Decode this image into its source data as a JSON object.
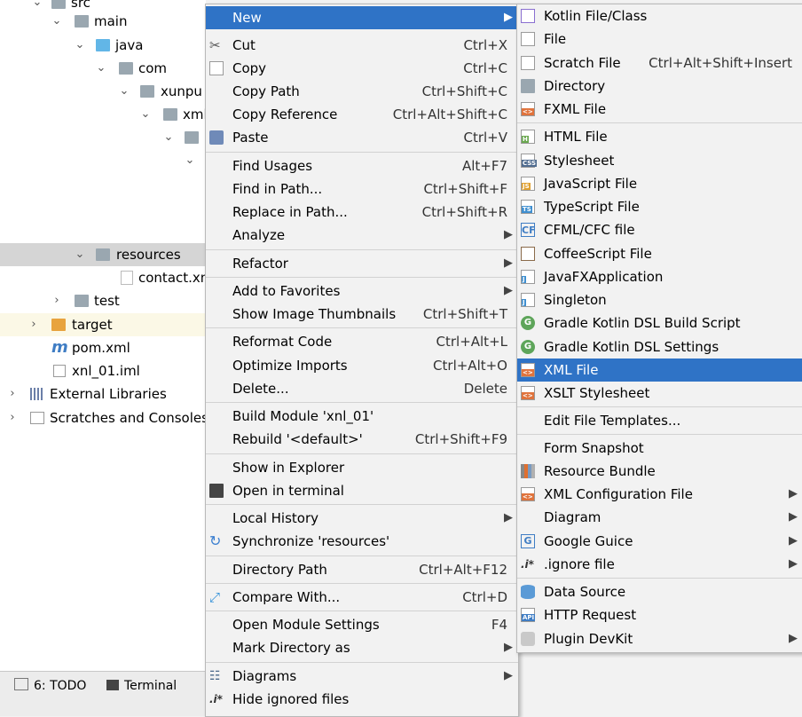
{
  "tree": {
    "rows": [
      {
        "label": "src"
      },
      {
        "label": "main"
      },
      {
        "label": "java"
      },
      {
        "label": "com"
      },
      {
        "label": "xunpu"
      },
      {
        "label": "xml"
      },
      {
        "label": "resources"
      },
      {
        "label": "contact.xml"
      },
      {
        "label": "test"
      },
      {
        "label": "target"
      },
      {
        "label": "pom.xml"
      },
      {
        "label": "xnl_01.iml"
      },
      {
        "label": "External Libraries"
      },
      {
        "label": "Scratches and Consoles"
      }
    ]
  },
  "bottom_tabs": [
    {
      "label": "6: TODO"
    },
    {
      "label": "Terminal"
    }
  ],
  "context_menu": [
    {
      "label": "New",
      "shortcut": ""
    },
    {
      "label": "Cut",
      "shortcut": "Ctrl+X"
    },
    {
      "label": "Copy",
      "shortcut": "Ctrl+C"
    },
    {
      "label": "Copy Path",
      "shortcut": "Ctrl+Shift+C"
    },
    {
      "label": "Copy Reference",
      "shortcut": "Ctrl+Alt+Shift+C"
    },
    {
      "label": "Paste",
      "shortcut": "Ctrl+V"
    },
    {
      "label": "Find Usages",
      "shortcut": "Alt+F7"
    },
    {
      "label": "Find in Path...",
      "shortcut": "Ctrl+Shift+F"
    },
    {
      "label": "Replace in Path...",
      "shortcut": "Ctrl+Shift+R"
    },
    {
      "label": "Analyze",
      "shortcut": ""
    },
    {
      "label": "Refactor",
      "shortcut": ""
    },
    {
      "label": "Add to Favorites",
      "shortcut": ""
    },
    {
      "label": "Show Image Thumbnails",
      "shortcut": "Ctrl+Shift+T"
    },
    {
      "label": "Reformat Code",
      "shortcut": "Ctrl+Alt+L"
    },
    {
      "label": "Optimize Imports",
      "shortcut": "Ctrl+Alt+O"
    },
    {
      "label": "Delete...",
      "shortcut": "Delete"
    },
    {
      "label": "Build Module 'xnl_01'",
      "shortcut": ""
    },
    {
      "label": "Rebuild '<default>'",
      "shortcut": "Ctrl+Shift+F9"
    },
    {
      "label": "Show in Explorer",
      "shortcut": ""
    },
    {
      "label": "Open in terminal",
      "shortcut": ""
    },
    {
      "label": "Local History",
      "shortcut": ""
    },
    {
      "label": "Synchronize 'resources'",
      "shortcut": ""
    },
    {
      "label": "Directory Path",
      "shortcut": "Ctrl+Alt+F12"
    },
    {
      "label": "Compare With...",
      "shortcut": "Ctrl+D"
    },
    {
      "label": "Open Module Settings",
      "shortcut": "F4"
    },
    {
      "label": "Mark Directory as",
      "shortcut": ""
    },
    {
      "label": "Diagrams",
      "shortcut": ""
    },
    {
      "label": "Hide ignored files",
      "shortcut": ""
    }
  ],
  "new_submenu": [
    {
      "label": "Kotlin File/Class",
      "shortcut": ""
    },
    {
      "label": "File",
      "shortcut": ""
    },
    {
      "label": "Scratch File",
      "shortcut": "Ctrl+Alt+Shift+Insert"
    },
    {
      "label": "Directory",
      "shortcut": ""
    },
    {
      "label": "FXML File",
      "shortcut": ""
    },
    {
      "label": "HTML File",
      "shortcut": ""
    },
    {
      "label": "Stylesheet",
      "shortcut": ""
    },
    {
      "label": "JavaScript File",
      "shortcut": ""
    },
    {
      "label": "TypeScript File",
      "shortcut": ""
    },
    {
      "label": "CFML/CFC file",
      "shortcut": ""
    },
    {
      "label": "CoffeeScript File",
      "shortcut": ""
    },
    {
      "label": "JavaFXApplication",
      "shortcut": ""
    },
    {
      "label": "Singleton",
      "shortcut": ""
    },
    {
      "label": "Gradle Kotlin DSL Build Script",
      "shortcut": ""
    },
    {
      "label": "Gradle Kotlin DSL Settings",
      "shortcut": ""
    },
    {
      "label": "XML File",
      "shortcut": ""
    },
    {
      "label": "XSLT Stylesheet",
      "shortcut": ""
    },
    {
      "label": "Edit File Templates...",
      "shortcut": ""
    },
    {
      "label": "Form Snapshot",
      "shortcut": ""
    },
    {
      "label": "Resource Bundle",
      "shortcut": ""
    },
    {
      "label": "XML Configuration File",
      "shortcut": ""
    },
    {
      "label": "Diagram",
      "shortcut": ""
    },
    {
      "label": "Google Guice",
      "shortcut": ""
    },
    {
      "label": ".ignore file",
      "shortcut": ""
    },
    {
      "label": "Data Source",
      "shortcut": ""
    },
    {
      "label": "HTTP Request",
      "shortcut": ""
    },
    {
      "label": "Plugin DevKit",
      "shortcut": ""
    }
  ],
  "icon_tags": {
    "fxml": "<>",
    "html": "H",
    "css": "CSS",
    "js": "JS",
    "ts": "TS",
    "cf": "CF",
    "api": "API",
    "ignore": ".i*"
  },
  "colors": {
    "highlight": "#2f73c6",
    "menu_bg": "#f2f2f2",
    "selected_row": "#d5d5d5"
  }
}
